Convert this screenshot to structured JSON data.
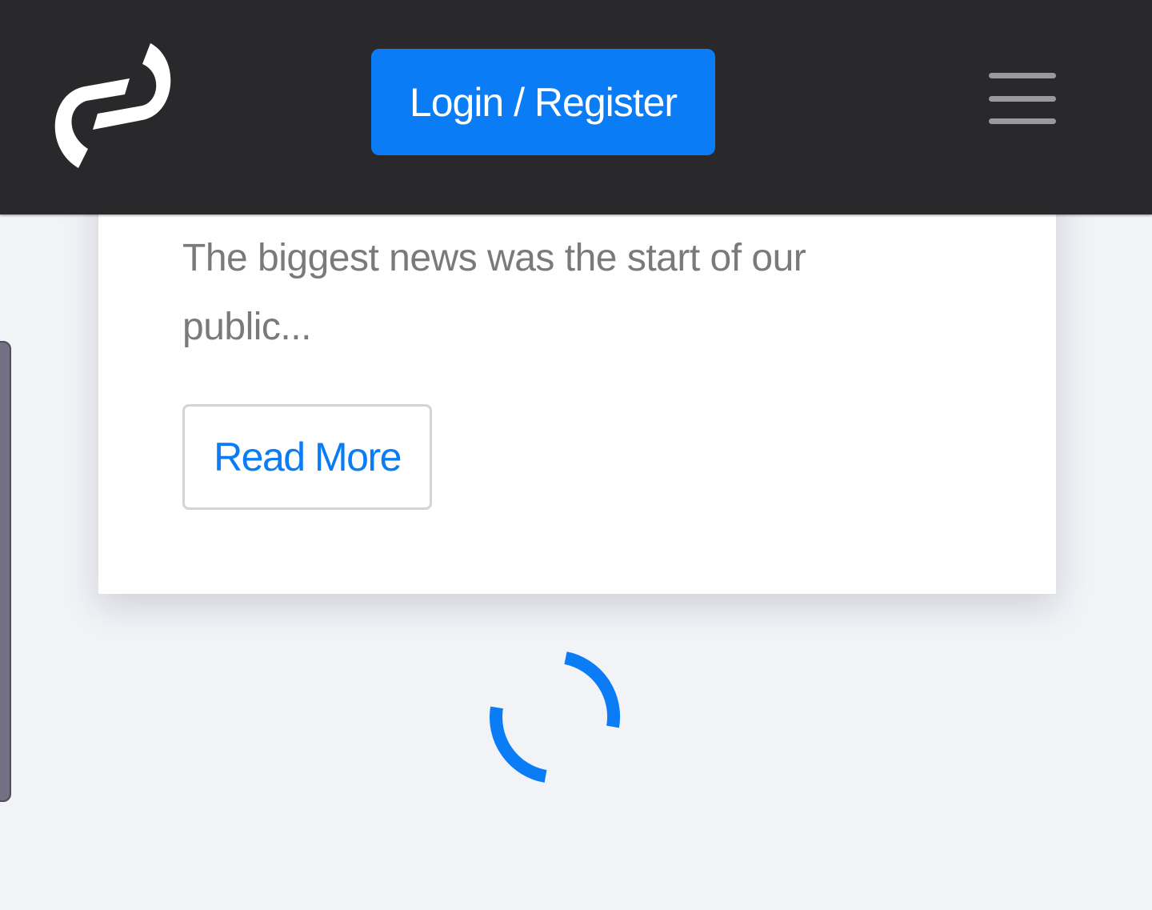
{
  "header": {
    "logo_icon": "app-logo-icon",
    "login_label": "Login / Register",
    "menu_icon": "hamburger-menu-icon"
  },
  "card": {
    "excerpt": "The biggest news was the start of our public...",
    "read_more_label": "Read More"
  },
  "loader": {
    "icon": "loading-spinner-icon"
  },
  "colors": {
    "header_bg": "#29292b",
    "accent": "#0a7cf5",
    "page_bg": "#f1f3f7",
    "card_bg": "#ffffff",
    "text_muted": "#7a7a7c"
  }
}
